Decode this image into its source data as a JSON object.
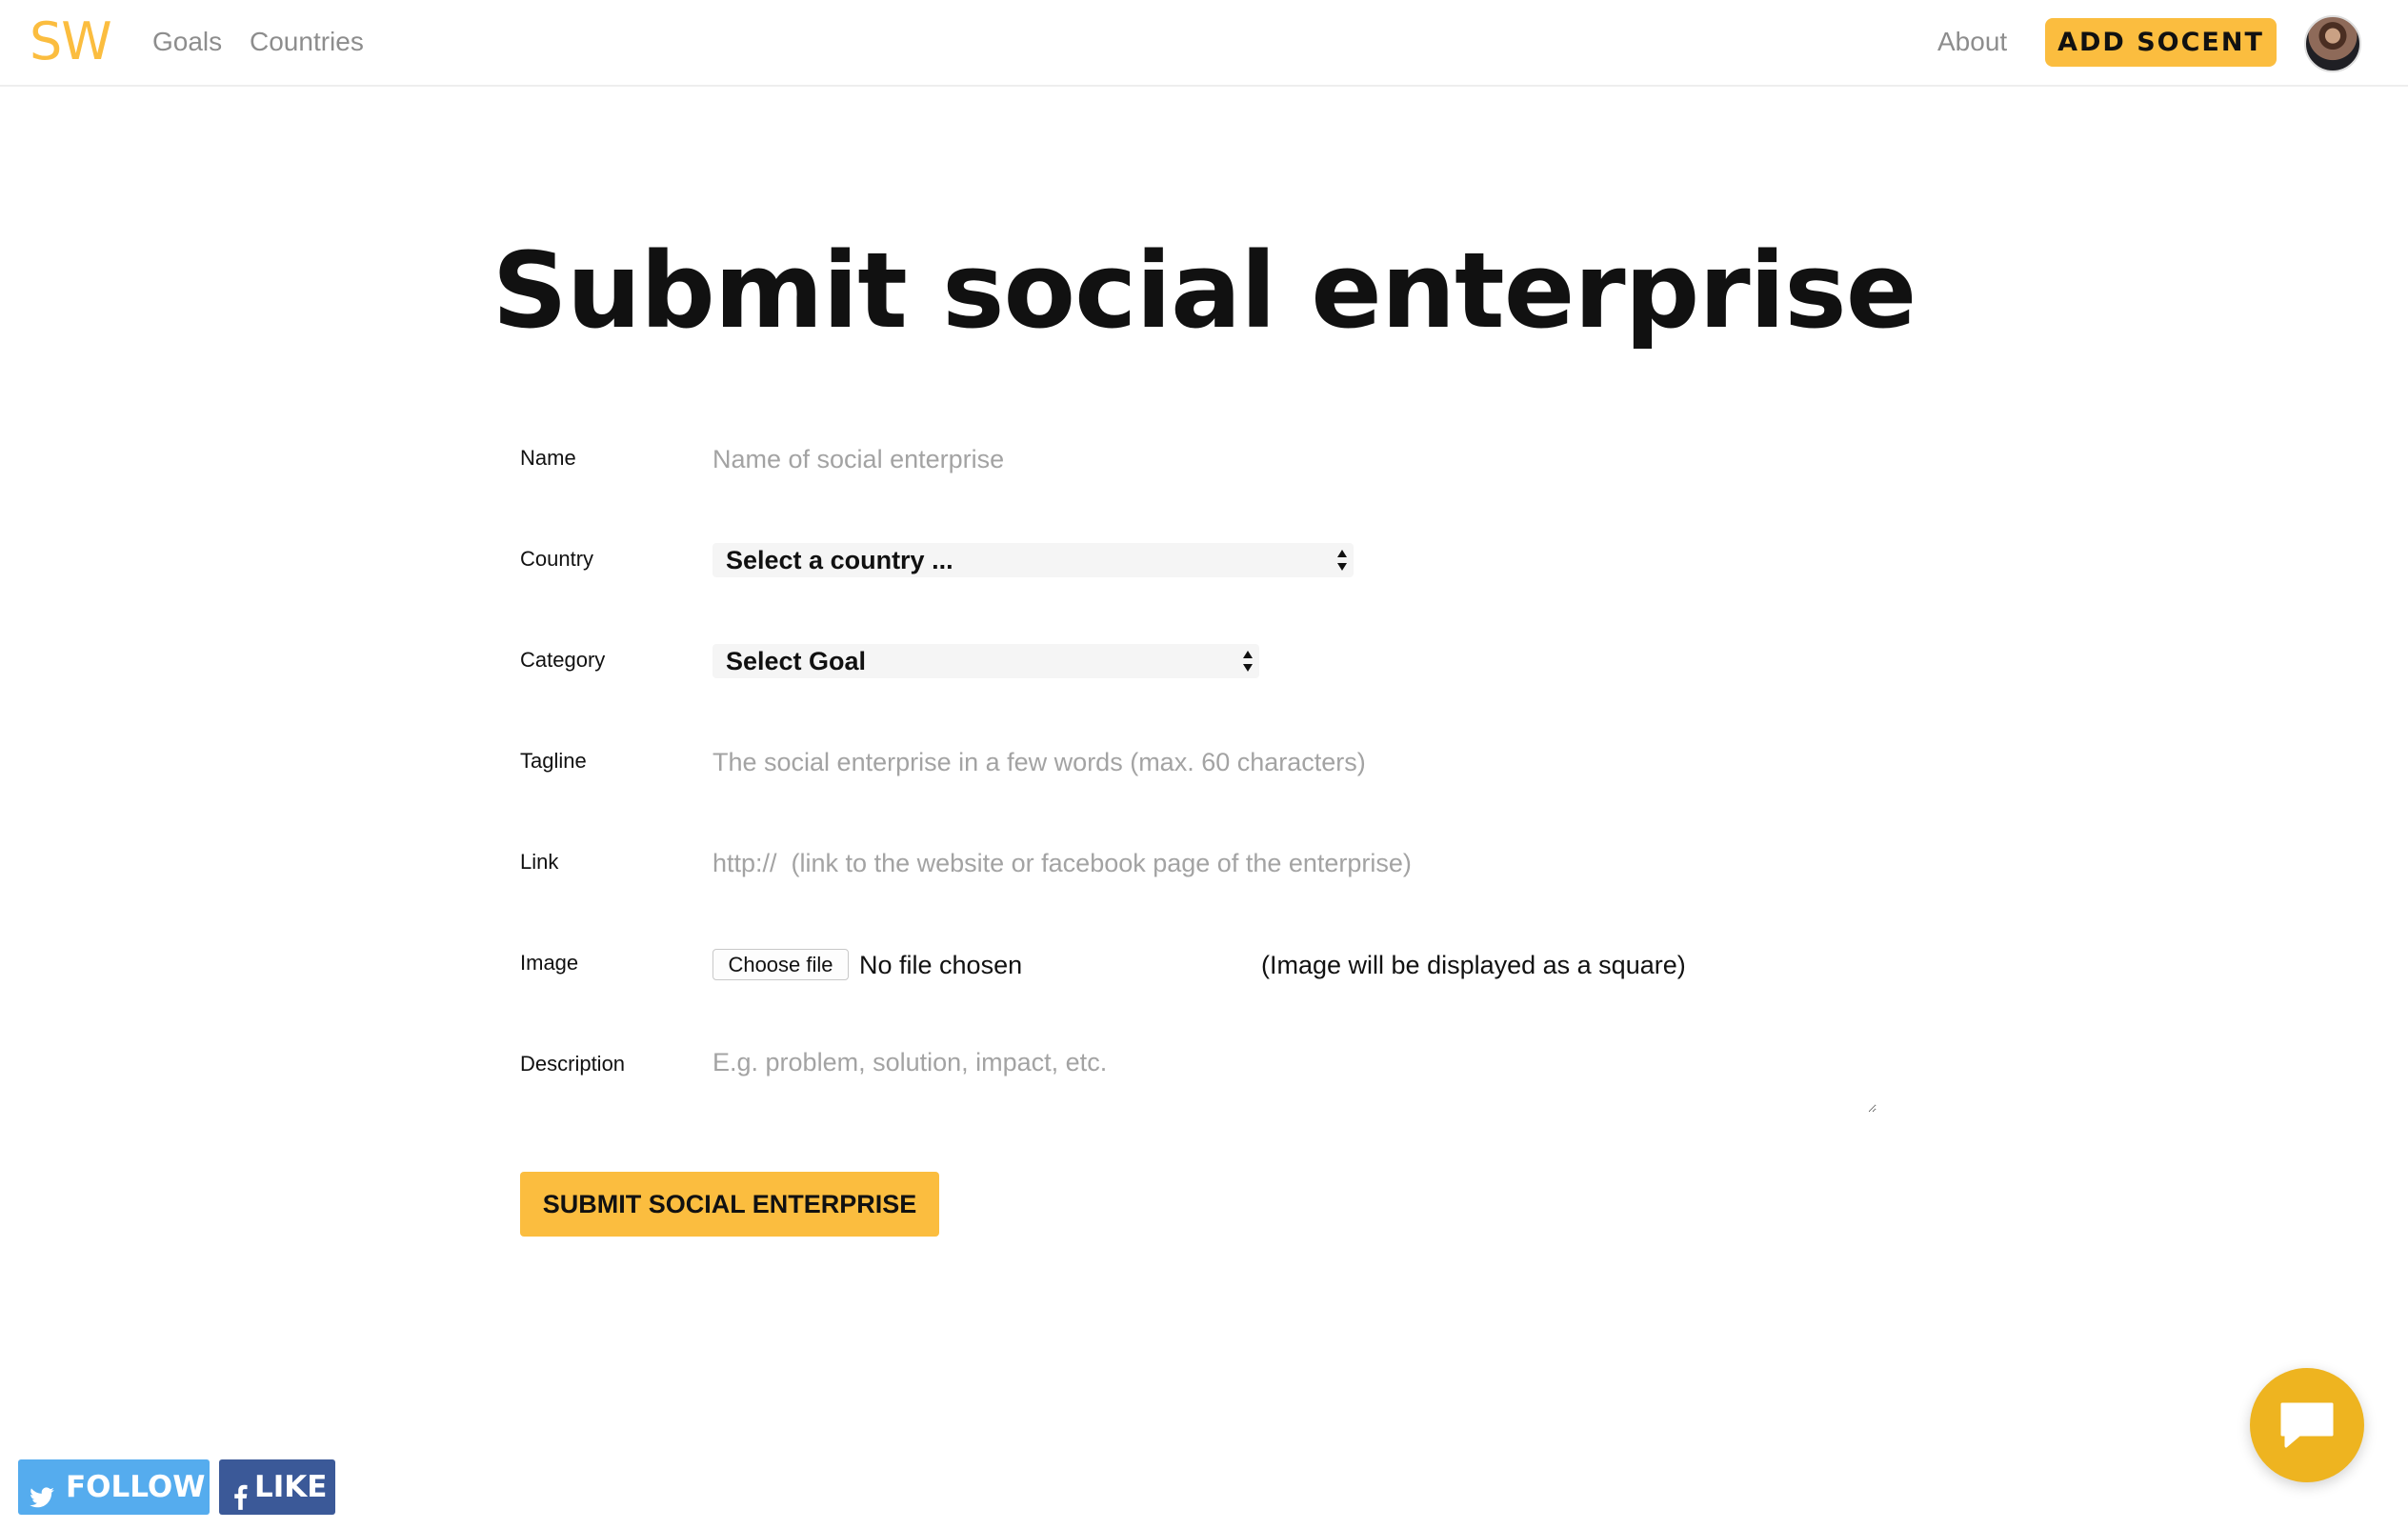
{
  "header": {
    "logo": "SW",
    "nav": {
      "goals": "Goals",
      "countries": "Countries"
    },
    "about": "About",
    "add_socent": "ADD SOCENT",
    "avatar_icon": "user-avatar"
  },
  "title": "Submit social enterprise",
  "form": {
    "name": {
      "label": "Name",
      "placeholder": "Name of social enterprise",
      "value": ""
    },
    "country": {
      "label": "Country",
      "selected": "Select a country ...",
      "icon": "select-arrows-icon"
    },
    "category": {
      "label": "Category",
      "selected": "Select Goal",
      "icon": "select-arrows-icon"
    },
    "tagline": {
      "label": "Tagline",
      "placeholder": "The social enterprise in a few words (max. 60 characters)",
      "value": ""
    },
    "link": {
      "label": "Link",
      "placeholder": "http://  (link to the website or facebook page of the enterprise)",
      "value": ""
    },
    "image": {
      "label": "Image",
      "button": "Choose file",
      "status": "No file chosen",
      "note": "(Image will be displayed as a square)"
    },
    "description": {
      "label": "Description",
      "placeholder": "E.g. problem, solution, impact, etc.",
      "value": ""
    },
    "submit": "SUBMIT SOCIAL ENTERPRISE"
  },
  "social": {
    "follow": "FOLLOW",
    "follow_icon": "twitter-icon",
    "like": "LIKE",
    "like_icon": "facebook-icon"
  },
  "chat": {
    "icon": "chat-bubble-icon"
  },
  "colors": {
    "accent": "#fbbd3f",
    "twitter": "#55acee",
    "facebook": "#3b5998",
    "chat": "#eeb420",
    "muted_text": "#8d8d8d",
    "placeholder": "#a3a3a3"
  }
}
